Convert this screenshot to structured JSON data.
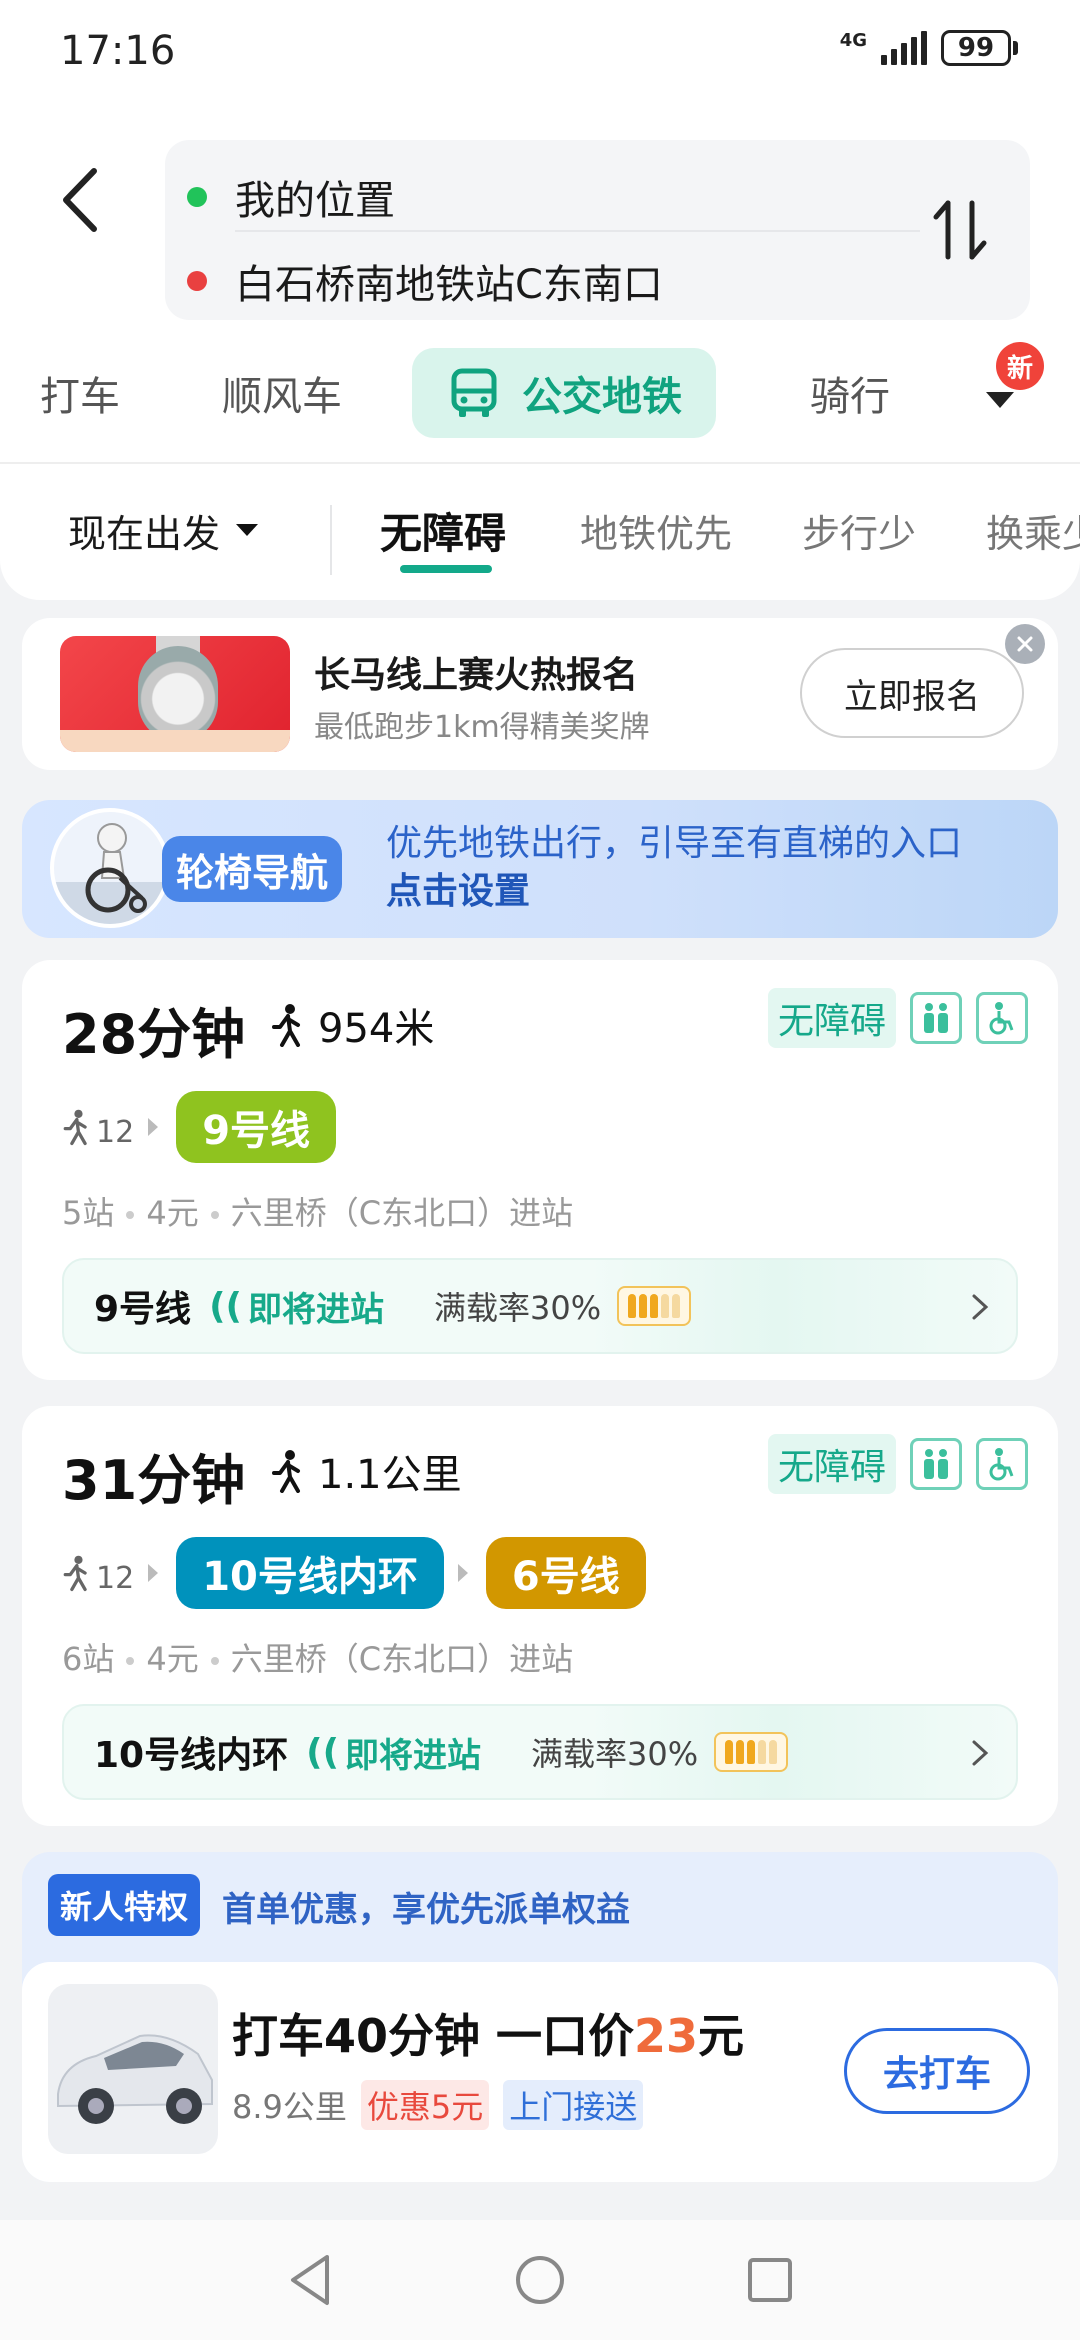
{
  "status_bar": {
    "time": "17:16",
    "network": "4G",
    "battery": "99"
  },
  "route": {
    "from": "我的位置",
    "to": "白石桥南地铁站C东南口",
    "from_color": "#21c35a",
    "to_color": "#e94040"
  },
  "modes": {
    "taxi": "打车",
    "carpool": "顺风车",
    "transit": "公交地铁",
    "ride": "骑行",
    "new_badge": "新"
  },
  "prefs": {
    "depart": "现在出发",
    "tabs": [
      "无障碍",
      "地铁优先",
      "步行少",
      "换乘少"
    ]
  },
  "promo": {
    "title": "长马线上赛火热报名",
    "subtitle": "最低跑步1km得精美奖牌",
    "button": "立即报名"
  },
  "wheelchair": {
    "tag": "轮椅导航",
    "text": "优先地铁出行，引导至有直梯的入口",
    "action": "点击设置"
  },
  "routes": [
    {
      "time": "28分钟",
      "walk": "954米",
      "accessible": "无障碍",
      "walk_minutes": "12",
      "lines": [
        {
          "name": "9号线",
          "color": "#8fc31f"
        }
      ],
      "meta": {
        "stops": "5站",
        "fare": "4元",
        "entry": "六里桥（C东北口）进站"
      },
      "live": {
        "line": "9号线",
        "wave": "((",
        "status": "即将进站",
        "load": "满载率30%"
      }
    },
    {
      "time": "31分钟",
      "walk": "1.1公里",
      "accessible": "无障碍",
      "walk_minutes": "12",
      "lines": [
        {
          "name": "10号线内环",
          "color": "#0092bc"
        },
        {
          "name": "6号线",
          "color": "#d29700"
        }
      ],
      "meta": {
        "stops": "6站",
        "fare": "4元",
        "entry": "六里桥（C东北口）进站"
      },
      "live": {
        "line": "10号线内环",
        "wave": "((",
        "status": "即将进站",
        "load": "满载率30%"
      }
    }
  ],
  "taxi_offer": {
    "tag": "新人特权",
    "headline": "首单优惠，享优先派单权益",
    "title_prefix": "打车40分钟 一口价",
    "price": "23",
    "title_suffix": "元",
    "distance": "8.9公里",
    "discount": "优惠5元",
    "pickup": "上门接送",
    "button": "去打车"
  }
}
